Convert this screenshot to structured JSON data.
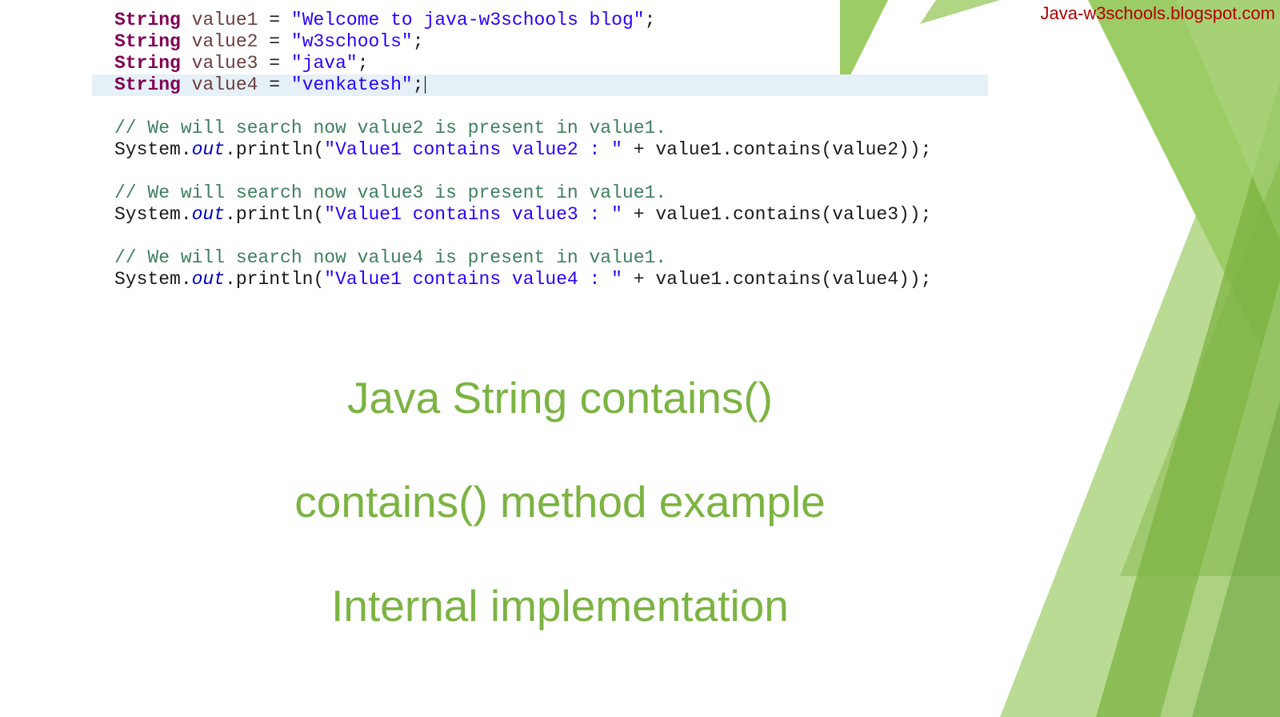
{
  "watermark": "Java-w3schools.blogspot.com",
  "code": {
    "l1": {
      "type": "String",
      "var": "value1",
      "eq": " = ",
      "str": "\"Welcome to java-w3schools blog\"",
      "end": ";"
    },
    "l2": {
      "type": "String",
      "var": "value2",
      "eq": " = ",
      "str": "\"w3schools\"",
      "end": ";"
    },
    "l3": {
      "type": "String",
      "var": "value3",
      "eq": " = ",
      "str": "\"java\"",
      "end": ";"
    },
    "l4": {
      "type": "String",
      "var": "value4",
      "eq": " = ",
      "str": "\"venkatesh\"",
      "end": ";"
    },
    "c2": "// We will search now value2 is present in value1.",
    "p2a": "System.",
    "p2out": "out",
    "p2b": ".println(",
    "p2str": "\"Value1 contains value2 : \"",
    "p2c": " + value1.contains(value2));",
    "c3": "// We will search now value3 is present in value1.",
    "p3a": "System.",
    "p3out": "out",
    "p3b": ".println(",
    "p3str": "\"Value1 contains value3 : \"",
    "p3c": " + value1.contains(value3));",
    "c4": "// We will search now value4 is present in value1.",
    "p4a": "System.",
    "p4out": "out",
    "p4b": ".println(",
    "p4str": "\"Value1 contains value4 : \"",
    "p4c": " + value1.contains(value4));"
  },
  "titles": {
    "line1": "Java String contains()",
    "line2": "contains() method example",
    "line3": "Internal implementation"
  }
}
